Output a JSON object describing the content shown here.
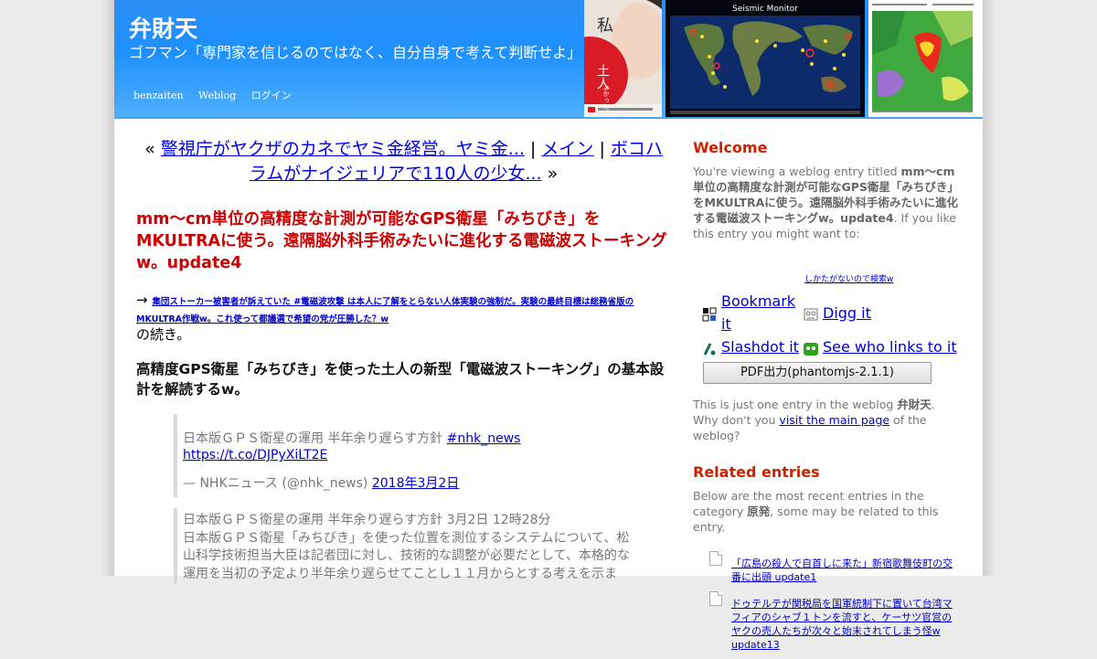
{
  "site": {
    "title": "弁財天",
    "description": "ゴフマン「専門家を信じるのではなく、自分自身で考えて判断せよ」",
    "nav": [
      "benzaiten",
      "Weblog",
      "ログイン"
    ]
  },
  "header_images": {
    "poster_text": [
      "私",
      "土人",
      "よかった。"
    ],
    "seismic_title": "Seismic Monitor"
  },
  "pager": {
    "prev_marker": "«",
    "prev_title": "警視庁がヤクザのカネでヤミ金経営。ヤミ金...",
    "sep": "|",
    "main": "メイン",
    "next_title": "ボコハラムがナイジェリアで110人の少女...",
    "next_marker": "»"
  },
  "entry": {
    "title": "mm～cm単位の高精度な計測が可能なGPS衛星「みちびき」をMKULTRAに使う。遠隔脳外科手術みたいに進化する電磁波ストーキングw。update4",
    "arrow": "→",
    "continued_link": "集団ストーカー被害者が訴えていた #電磁波攻撃 は本人に了解をとらない人体実験の強制だ。実験の最終目標は総務省版のMKULTRA作戦w。これ使って都議選で希望の党が圧勝した？w",
    "continued_suffix": "の続き。",
    "subhead": "高精度GPS衛星「みちびき」を使った土人の新型「電磁波ストーキング」の基本設計を解読するw。",
    "quote1_text": "日本版ＧＰＳ衛星の運用 半年余り遅らす方針 ",
    "quote1_hashtag": "#nhk_news",
    "quote1_url": "https://t.co/DJPyXiLT2E",
    "quote1_by": "— NHKニュース (@nhk_news) ",
    "quote1_date": "2018年3月2日",
    "quote2": "日本版ＧＰＳ衛星の運用 半年余り遅らす方針 3月2日 12時28分\n日本版ＧＰＳ衛星「みちびき」を使った位置を測位するシステムについて、松山科学技術担当大臣は記者団に対し、技術的な調整が必要だとして、本格的な運用を当初の予定より半年余り遅らせてことし１１月からとする考えを示ま"
  },
  "sidebar": {
    "welcome_heading": "Welcome",
    "welcome_pre": "You're viewing a weblog entry titled ",
    "welcome_title": "mm～cm単位の高精度な計測が可能なGPS衛星「みちびき」をMKULTRAに使う。遠隔脳外科手術みたいに進化する電磁波ストーキングw。update4",
    "welcome_post": ". If you like this entry you might want to:",
    "small_link": "しかたがないので検索w",
    "share": {
      "bookmark": "Bookmark it",
      "digg": "Digg it",
      "slashdot": "Slashdot it",
      "see_who": "See who links to it"
    },
    "pdf_button": "PDF出力(phantomjs-2.1.1)",
    "just_one_pre": "This is just one entry in the weblog ",
    "just_one_blog": "弁財天",
    "just_one_mid": ". Why don't you ",
    "just_one_link": "visit the main page",
    "just_one_post": " of the weblog?",
    "related_heading": "Related entries",
    "related_pre": "Below are the most recent entries in the category ",
    "related_category": "原発",
    "related_post": ", some may be related to this entry.",
    "related_items": [
      "「広島の殺人で自首しに来た」新宿歌舞伎町の交番に出頭 update1",
      "ドゥテルテが関税局を国軍統制下に置いて台湾マフィアのシャブ１トンを流すと、ケーサツ官営のヤクの売人たちが次々と始末されてしまう怪w update13"
    ]
  }
}
